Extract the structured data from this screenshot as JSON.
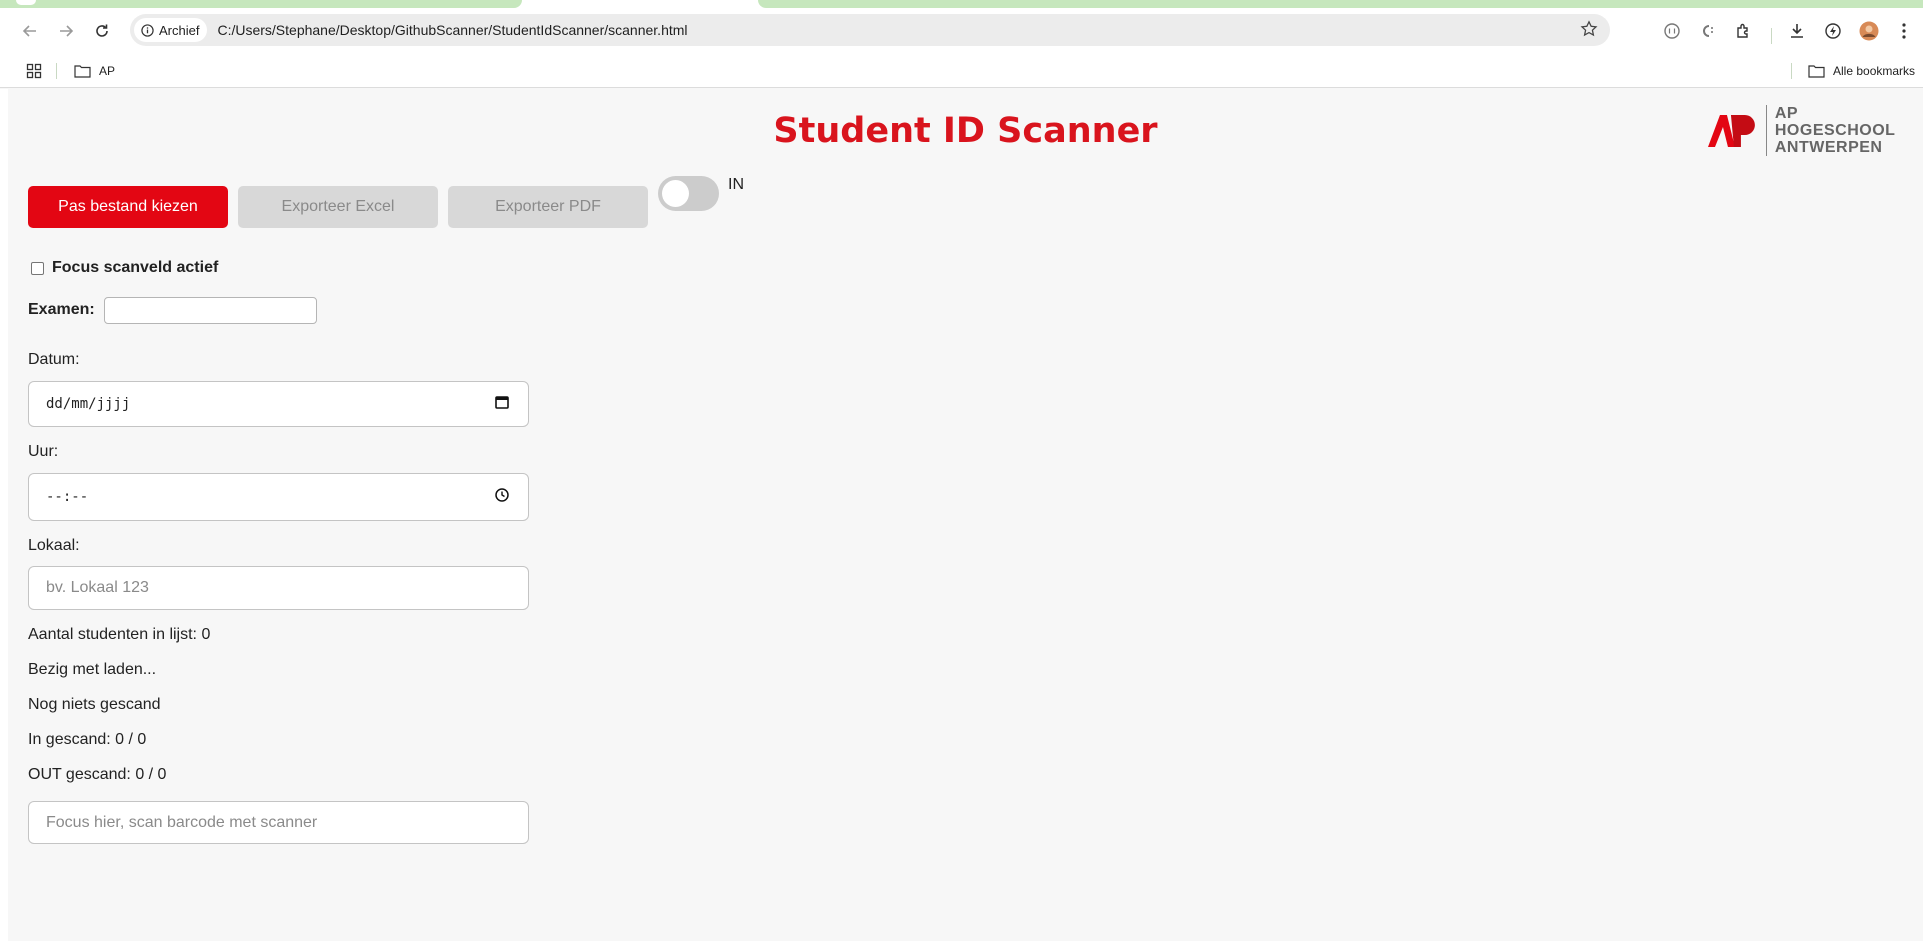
{
  "browser": {
    "url_chip": "Archief",
    "url": "C:/Users/Stephane/Desktop/GithubScanner/StudentIdScanner/scanner.html",
    "bookmarks": {
      "folder": "AP",
      "all_bookmarks": "Alle bookmarks"
    }
  },
  "page": {
    "title": "Student ID Scanner",
    "logo": {
      "line1": "AP HOGESCHOOL",
      "line2": "ANTWERPEN"
    },
    "buttons": {
      "choose_file": "Pas bestand kiezen",
      "export_excel": "Exporteer Excel",
      "export_pdf": "Exporteer PDF"
    },
    "toggle": {
      "label": "IN",
      "on": false
    },
    "focus_checkbox": {
      "label": "Focus scanveld actief",
      "checked": false
    },
    "examen": {
      "label": "Examen:",
      "value": ""
    },
    "datum": {
      "label": "Datum:",
      "value": "dd/mm/jjjj"
    },
    "uur": {
      "label": "Uur:",
      "value": "--:--"
    },
    "lokaal": {
      "label": "Lokaal:",
      "placeholder": "bv. Lokaal 123"
    },
    "status": {
      "aantal": "Aantal studenten in lijst: 0",
      "loading": "Bezig met laden...",
      "last_scan": "Nog niets gescand",
      "in_scanned": "In gescand: 0 / 0",
      "out_scanned": "OUT gescand: 0 / 0"
    },
    "scan_input": {
      "placeholder": "Focus hier, scan barcode met scanner"
    },
    "colors": {
      "brand_red": "#e30613",
      "title_red": "#d9141d",
      "disabled_gray": "#d8d8d8"
    }
  }
}
